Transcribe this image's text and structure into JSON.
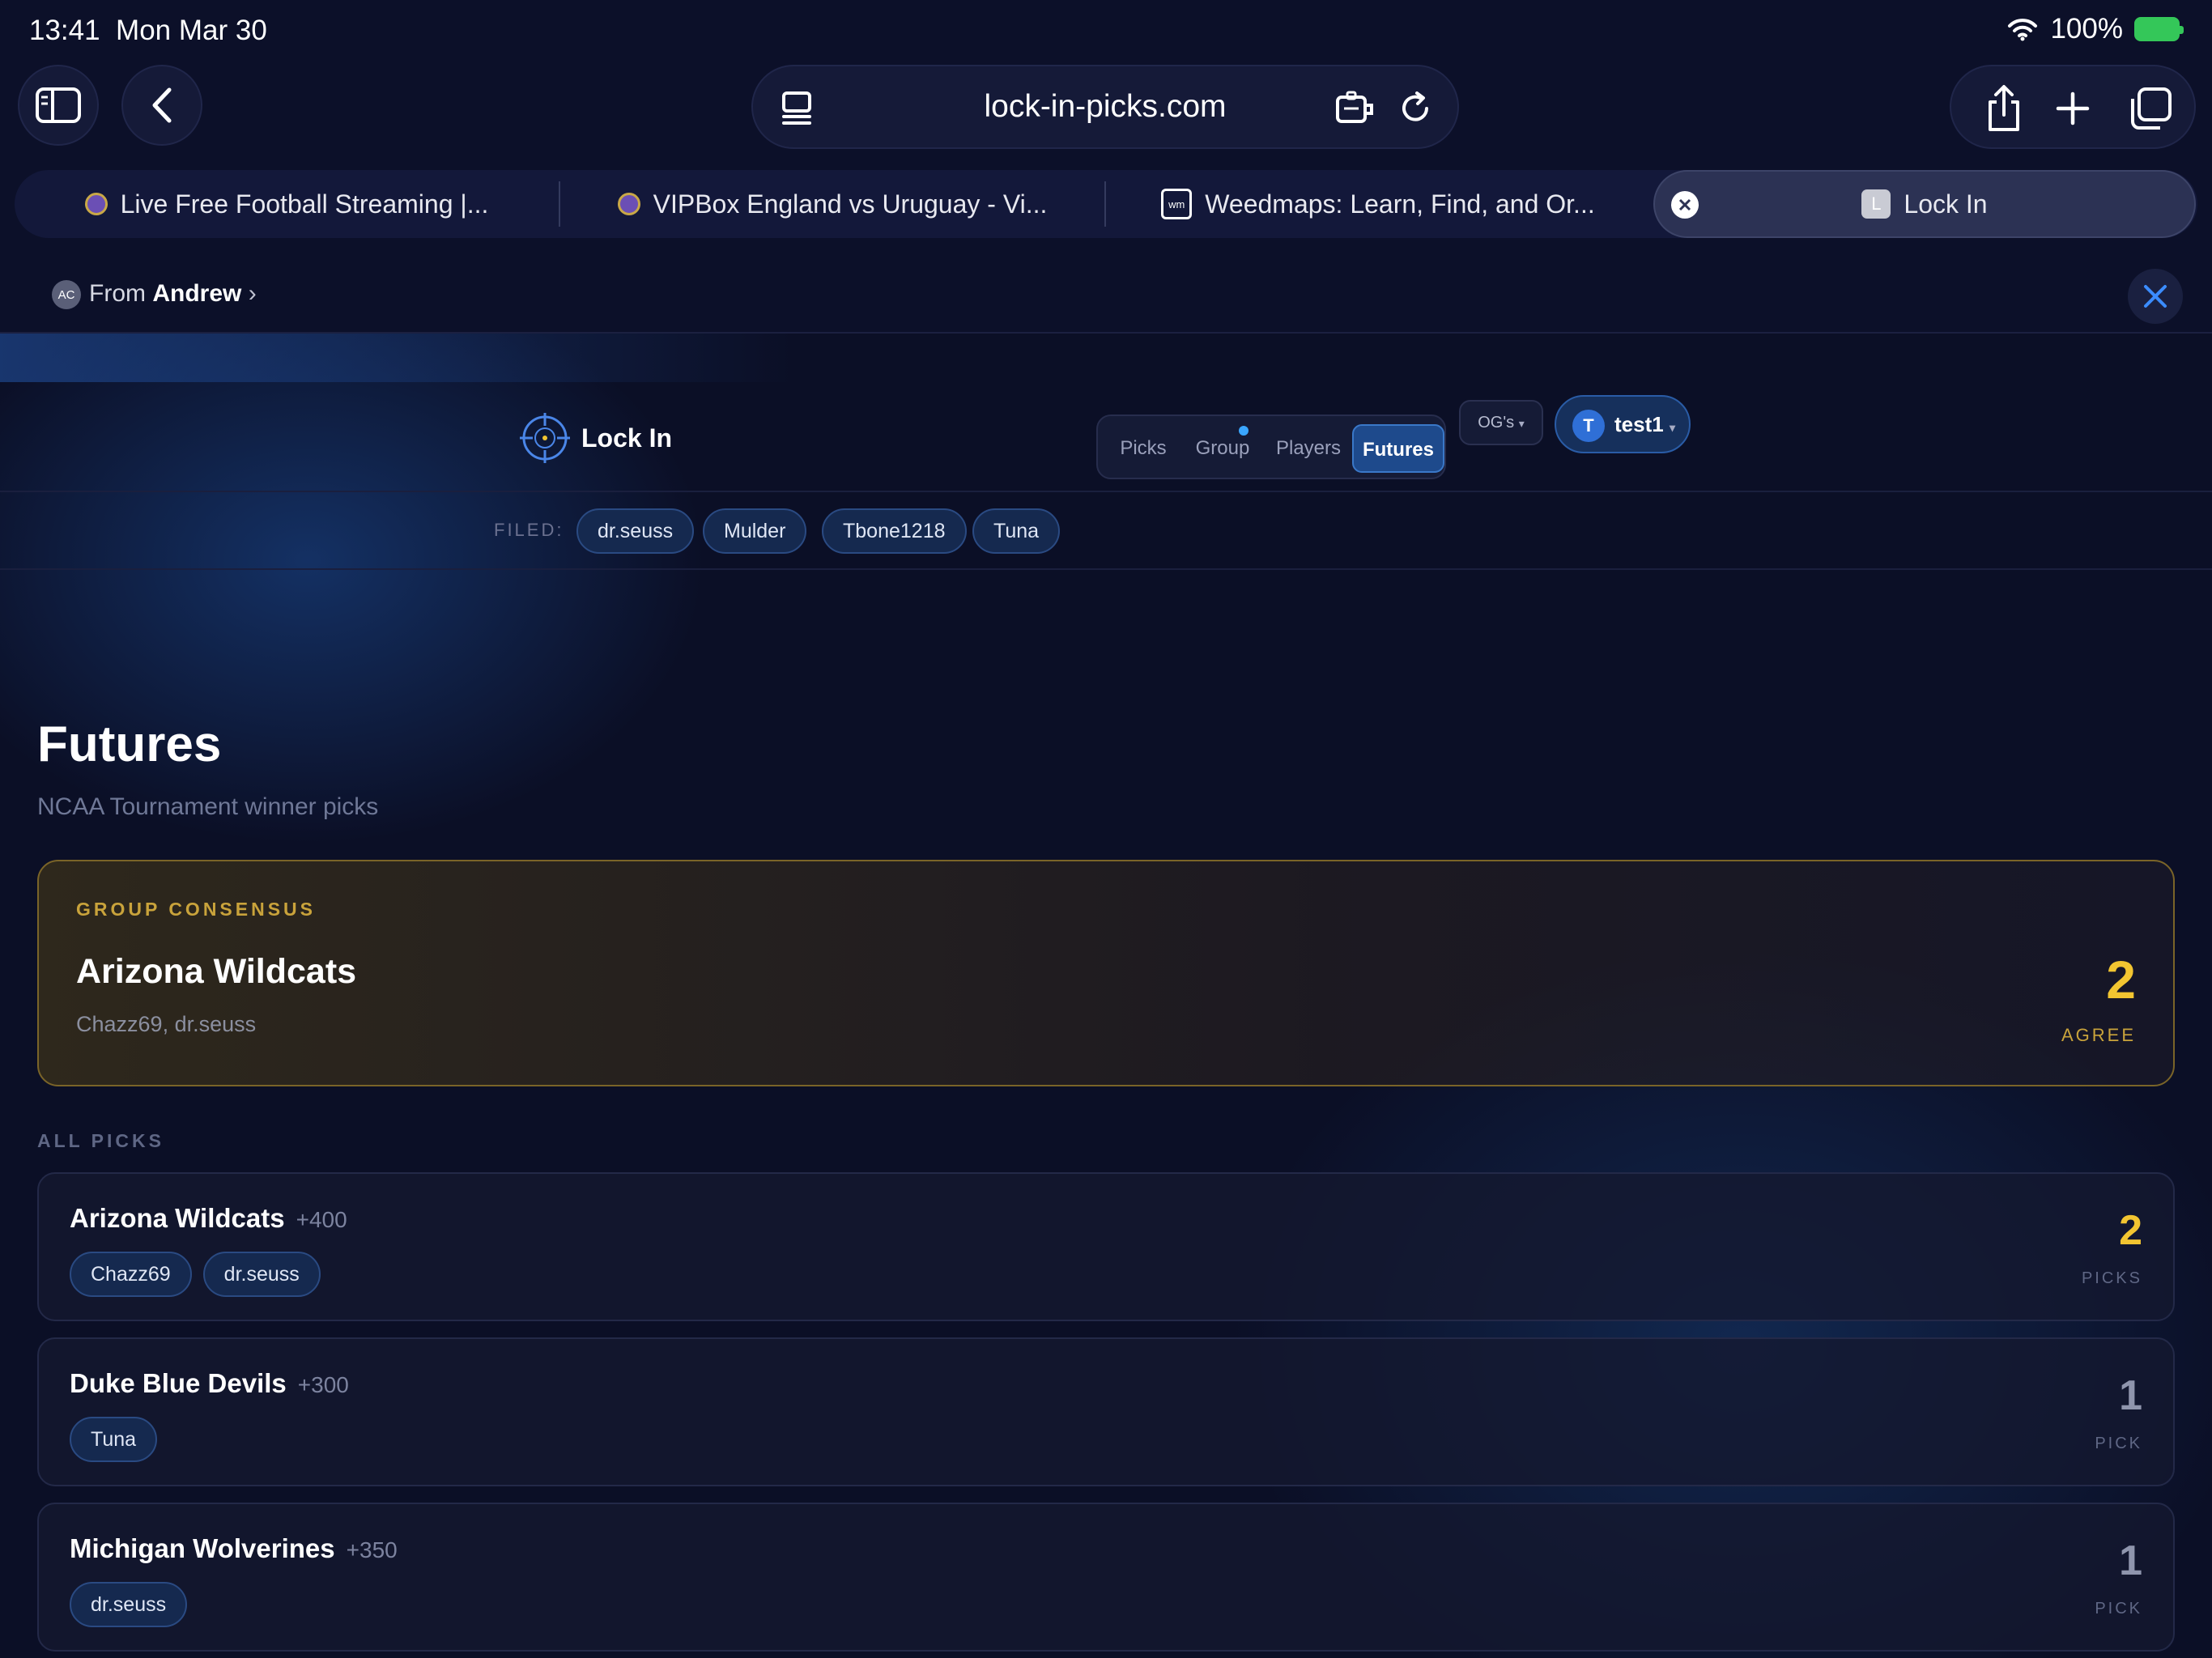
{
  "status_bar": {
    "time": "13:41",
    "date": "Mon Mar 30",
    "battery": "100%"
  },
  "browser": {
    "url": "lock-in-picks.com",
    "tabs": [
      {
        "label": "Live Free Football Streaming |..."
      },
      {
        "label": "VIPBox England vs Uruguay - Vi..."
      },
      {
        "label": "Weedmaps: Learn, Find, and Or..."
      },
      {
        "label": "Lock In",
        "favicon_letter": "L"
      }
    ],
    "weedmaps_favicon": "wm",
    "shared_from": {
      "prefix": "From",
      "name": "Andrew",
      "initials": "AC"
    }
  },
  "app": {
    "logo_text": "Lock In",
    "nav": [
      {
        "label": "Picks"
      },
      {
        "label": "Group"
      },
      {
        "label": "Players"
      },
      {
        "label": "Futures"
      }
    ],
    "group_selector": "OG's",
    "user": {
      "initial": "T",
      "name": "test1"
    },
    "filed_label": "FILED:",
    "filed": [
      "dr.seuss",
      "Mulder",
      "Tbone1218",
      "Tuna"
    ]
  },
  "page": {
    "title": "Futures",
    "subtitle": "NCAA Tournament winner picks",
    "consensus": {
      "label": "GROUP CONSENSUS",
      "team": "Arizona Wildcats",
      "names": "Chazz69, dr.seuss",
      "count": "2",
      "unit": "AGREE"
    },
    "all_picks_label": "ALL PICKS",
    "picks": [
      {
        "team": "Arizona Wildcats",
        "odds": "+400",
        "pickers": [
          "Chazz69",
          "dr.seuss"
        ],
        "count": "2",
        "unit": "PICKS"
      },
      {
        "team": "Duke Blue Devils",
        "odds": "+300",
        "pickers": [
          "Tuna"
        ],
        "count": "1",
        "unit": "PICK"
      },
      {
        "team": "Michigan Wolverines",
        "odds": "+350",
        "pickers": [
          "dr.seuss"
        ],
        "count": "1",
        "unit": "PICK"
      }
    ]
  },
  "colors": {
    "background": "#0b0f26",
    "accent_blue": "#1e4a8c",
    "consensus_gold": "#f2c531",
    "muted_count": "#8f95ad"
  }
}
